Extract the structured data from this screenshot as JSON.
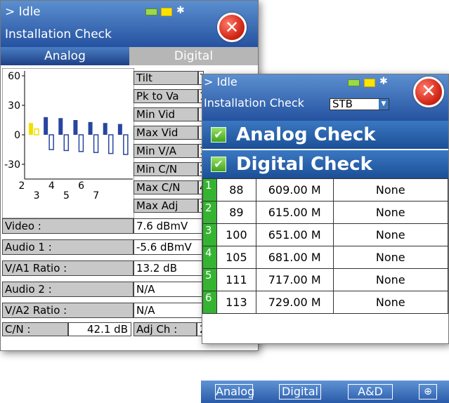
{
  "back": {
    "status": "> Idle",
    "title": "Installation Check",
    "tabs": [
      "Analog",
      "Digital"
    ],
    "chart_data": {
      "type": "bar",
      "ylim": [
        -45,
        65
      ],
      "y_ticks": [
        "60",
        "30",
        "0",
        "-30"
      ],
      "x_ticks_top": [
        "2",
        "4",
        "6"
      ],
      "x_ticks_bottom": [
        "3",
        "5",
        "7"
      ],
      "colors": {
        "video": "#2845a0",
        "audio_outline": "#2845a0",
        "highlight": "#f0e000"
      },
      "series": [
        {
          "values": [
            12,
            18,
            17,
            15,
            13,
            12,
            11
          ]
        },
        {
          "values": [
            6,
            -15,
            -16,
            -17,
            -18,
            -19,
            -20
          ]
        }
      ]
    },
    "meas_labels": [
      "Tilt",
      "Pk to Va",
      "Min Vid",
      "Max Vid",
      "Min V/A",
      "Min C/N",
      "Max C/N",
      "Max Adj"
    ],
    "meas_values": [
      "7",
      "1",
      "",
      "",
      "1",
      "3",
      "4",
      "1"
    ],
    "rows": [
      {
        "label": "Video :",
        "value": "7.6 dBmV"
      },
      {
        "label": "Audio 1 :",
        "value": "-5.6 dBmV"
      },
      {
        "label": "V/A1 Ratio :",
        "value": "13.2 dB"
      },
      {
        "label": "Audio 2 :",
        "value": "N/A"
      },
      {
        "label": "V/A2 Ratio :",
        "value": "N/A"
      }
    ],
    "cn": {
      "label": "C/N :",
      "value": "42.1 dB",
      "adj_label": "Adj Ch :",
      "adj_value": "2"
    }
  },
  "front": {
    "status": "> Idle",
    "title": "Installation Check",
    "mode": "STB",
    "checks": [
      "Analog Check",
      "Digital Check"
    ],
    "table": [
      {
        "idx": "1",
        "ch": "88",
        "freq": "609.00 M",
        "result": "None"
      },
      {
        "idx": "2",
        "ch": "89",
        "freq": "615.00 M",
        "result": "None"
      },
      {
        "idx": "3",
        "ch": "100",
        "freq": "651.00 M",
        "result": "None"
      },
      {
        "idx": "4",
        "ch": "105",
        "freq": "681.00 M",
        "result": "None"
      },
      {
        "idx": "5",
        "ch": "111",
        "freq": "717.00 M",
        "result": "None"
      },
      {
        "idx": "6",
        "ch": "113",
        "freq": "729.00 M",
        "result": "None"
      }
    ]
  },
  "bottom": {
    "buttons": [
      "Analog",
      "Digital",
      "A&D"
    ]
  }
}
